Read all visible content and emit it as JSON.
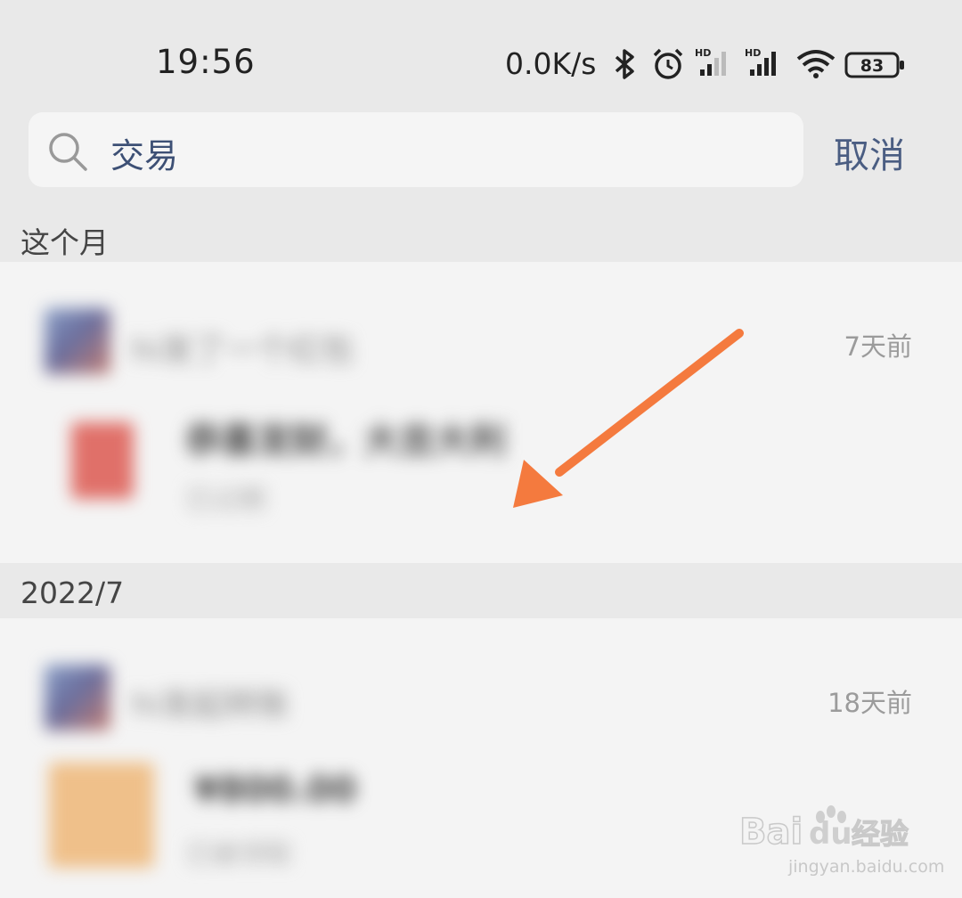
{
  "status_bar": {
    "time": "19:56",
    "net_speed": "0.0K/s",
    "battery": "83",
    "icons": [
      "bluetooth-icon",
      "alarm-icon",
      "signal-hd-icon",
      "signal-hd-icon",
      "wifi-icon",
      "battery-icon"
    ]
  },
  "search": {
    "query": "交易",
    "cancel_label": "取消"
  },
  "sections": [
    {
      "header": "这个月",
      "item": {
        "title": "hi发了一个红包",
        "time": "7天前",
        "message_title": "恭喜发财，大吉大利",
        "message_sub": "已过期"
      }
    },
    {
      "header": "2022/7",
      "item": {
        "title": "hi发起转账",
        "time": "18天前",
        "message_title": "¥800.00",
        "message_sub": "已被领取"
      }
    }
  ],
  "watermark": {
    "logo": "Bai du 经验",
    "url": "jingyan.baidu.com"
  },
  "colors": {
    "accent": "#4a5d82",
    "arrow": "#f47a3e",
    "red_packet": "#e07069",
    "transfer": "#efc08a"
  }
}
